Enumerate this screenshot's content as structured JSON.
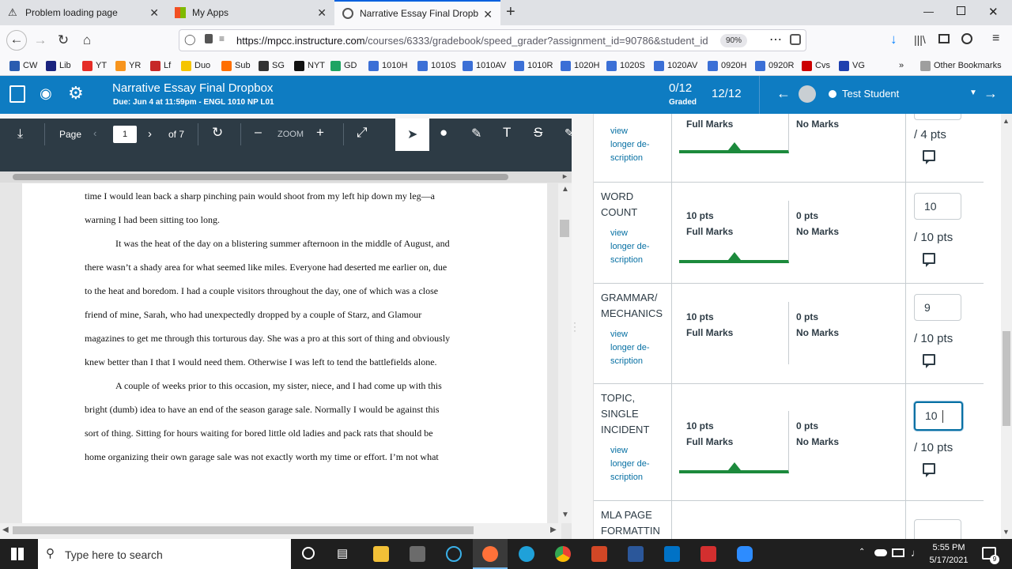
{
  "tabs": [
    {
      "title": "Problem loading page",
      "icon": "warning-icon"
    },
    {
      "title": "My Apps",
      "icon": "microsoft-icon"
    },
    {
      "title": "Narrative Essay Final Dropbox,",
      "icon": "canvas-icon"
    }
  ],
  "browser": {
    "url_domain": "https://mpcc.instructure.com",
    "url_path": "/courses/6333/gradebook/speed_grader?assignment_id=90786&student_id",
    "zoom": "90%"
  },
  "bookmarks": [
    {
      "label": "CW",
      "color": "#2a5db0"
    },
    {
      "label": "Lib",
      "color": "#1a237e"
    },
    {
      "label": "YT",
      "color": "#e52d27"
    },
    {
      "label": "YR",
      "color": "#f7941d"
    },
    {
      "label": "Lf",
      "color": "#c62828"
    },
    {
      "label": "Duo",
      "color": "#f5c400"
    },
    {
      "label": "Sub",
      "color": "#ff6f00"
    },
    {
      "label": "SG",
      "color": "#333333"
    },
    {
      "label": "NYT",
      "color": "#111111"
    },
    {
      "label": "GD",
      "color": "#1fa463"
    },
    {
      "label": "1010H",
      "color": "#3b6fd6"
    },
    {
      "label": "1010S",
      "color": "#3b6fd6"
    },
    {
      "label": "1010AV",
      "color": "#3b6fd6"
    },
    {
      "label": "1010R",
      "color": "#3b6fd6"
    },
    {
      "label": "1020H",
      "color": "#3b6fd6"
    },
    {
      "label": "1020S",
      "color": "#3b6fd6"
    },
    {
      "label": "1020AV",
      "color": "#3b6fd6"
    },
    {
      "label": "0920H",
      "color": "#3b6fd6"
    },
    {
      "label": "0920R",
      "color": "#3b6fd6"
    },
    {
      "label": "Cvs",
      "color": "#cc0000"
    },
    {
      "label": "VG",
      "color": "#1e40af"
    }
  ],
  "other_bookmarks": "Other Bookmarks",
  "header": {
    "title": "Narrative Essay Final Dropbox",
    "due": "Due: Jun 4 at 11:59pm - ENGL 1010 NP L01",
    "graded_count": "0/12",
    "graded_label": "Graded",
    "student_count": "12/12",
    "student_name": "Test Student"
  },
  "doc_toolbar": {
    "page_label": "Page",
    "page_value": "1",
    "page_total": "of 7",
    "zoom_label": "ZOOM"
  },
  "document": {
    "lines": [
      "time I would lean back a sharp pinching pain would shoot from my left hip down my leg—a",
      "warning I had been sitting too long.",
      "It was the heat of the day on a blistering summer afternoon in the middle of August, and",
      "there wasn’t a shady area for what seemed like miles.  Everyone had deserted me earlier on, due",
      "to the heat and boredom.  I had a couple visitors throughout the day, one of which was a close",
      "friend of mine, Sarah, who had unexpectedly dropped by a couple of Starz, and Glamour",
      "magazines to get me through this torturous day.  She was a pro at this sort of thing and obviously",
      "knew better than I that I would need them. Otherwise I was left to tend the battlefields alone.",
      "A couple of weeks prior to this occasion, my sister, niece, and I had come up with this",
      "bright (dumb) idea to have an end of the season garage sale.  Normally I would be against this",
      "sort of thing. Sitting for hours waiting for bored little old ladies and pack rats that should be",
      "home organizing their own garage sale was not exactly worth my time or effort.  I’m not what"
    ]
  },
  "rubric": {
    "view_longer": "view longer description",
    "top_partial": {
      "high_desc": "Full Marks",
      "low_desc": "No Marks",
      "out_of": "/ 4 pts"
    },
    "criteria": [
      {
        "name": "WORD COUNT",
        "high_pts": "10 pts",
        "high_desc": "Full Marks",
        "low_pts": "0 pts",
        "low_desc": "No Marks",
        "score": "10",
        "out_of": "/ 10 pts",
        "selected": true
      },
      {
        "name": "GRAMMAR/ MECHANICS",
        "high_pts": "10 pts",
        "high_desc": "Full Marks",
        "low_pts": "0 pts",
        "low_desc": "No Marks",
        "score": "9",
        "out_of": "/ 10 pts",
        "selected": false
      },
      {
        "name": "TOPIC, SINGLE INCIDENT",
        "high_pts": "10 pts",
        "high_desc": "Full Marks",
        "low_pts": "0 pts",
        "low_desc": "No Marks",
        "score": "10",
        "out_of": "/ 10 pts",
        "selected": true
      }
    ],
    "bottom_partial": {
      "name": "MLA PAGE FORMATTIN"
    }
  },
  "taskbar": {
    "search_placeholder": "Type here to search",
    "time": "5:55 PM",
    "date": "5/17/2021",
    "notification_count": "9"
  }
}
